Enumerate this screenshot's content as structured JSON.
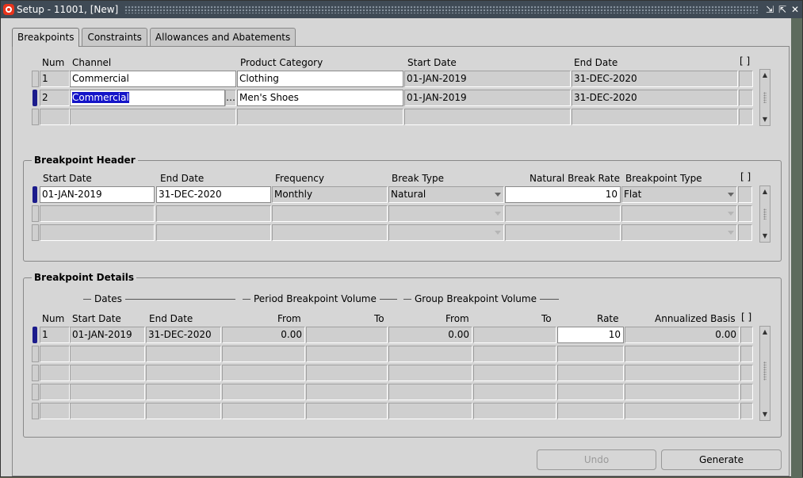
{
  "window": {
    "title": "Setup - 11001, [New]"
  },
  "tabs": [
    "Breakpoints",
    "Constraints",
    "Allowances and Abatements"
  ],
  "breakpoints": {
    "columns": [
      "Num",
      "Channel",
      "Product Category",
      "Start Date",
      "End Date",
      "[ ]"
    ],
    "rows": [
      {
        "num": "1",
        "channel": "Commercial",
        "product": "Clothing",
        "start": "01-JAN-2019",
        "end": "31-DEC-2020"
      },
      {
        "num": "2",
        "channel": "Commercial",
        "product": "Men's Shoes",
        "start": "01-JAN-2019",
        "end": "31-DEC-2020"
      }
    ],
    "ellipsis": "…"
  },
  "header_section": {
    "title": "Breakpoint Header",
    "columns": [
      "Start Date",
      "End Date",
      "Frequency",
      "Break Type",
      "Natural Break Rate",
      "Breakpoint Type",
      "[ ]"
    ],
    "rows": [
      {
        "start": "01-JAN-2019",
        "end": "31-DEC-2020",
        "frequency": "Monthly",
        "break_type": "Natural",
        "rate": "10",
        "bp_type": "Flat"
      }
    ]
  },
  "details_section": {
    "title": "Breakpoint Details",
    "groups": [
      "Dates",
      "Period Breakpoint Volume",
      "Group Breakpoint Volume"
    ],
    "columns": [
      "Num",
      "Start Date",
      "End Date",
      "From",
      "To",
      "From",
      "To",
      "Rate",
      "Annualized Basis",
      "[ ]"
    ],
    "rows": [
      {
        "num": "1",
        "start": "01-JAN-2019",
        "end": "31-DEC-2020",
        "pfrom": "0.00",
        "pto": "",
        "gfrom": "0.00",
        "gto": "",
        "rate": "10",
        "basis": "0.00"
      }
    ]
  },
  "buttons": {
    "undo": "Undo",
    "generate": "Generate"
  },
  "icons": {
    "scroll_up": "▲",
    "scroll_down": "▼",
    "minimize": "⇲",
    "maximize": "⇱",
    "close": "✕"
  }
}
